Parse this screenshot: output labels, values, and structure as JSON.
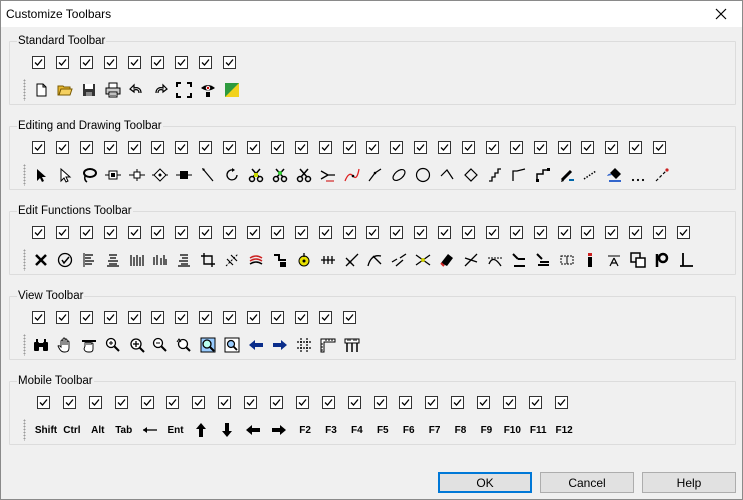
{
  "window": {
    "title": "Customize Toolbars"
  },
  "groups": {
    "standard": {
      "label": "Standard Toolbar",
      "icons": [
        "new-document-icon",
        "open-folder-icon",
        "save-icon",
        "print-icon",
        "undo-icon",
        "redo-icon",
        "full-extent-icon",
        "preview-eye-icon",
        "color-fill-icon"
      ]
    },
    "editing": {
      "label": "Editing and Drawing Toolbar",
      "icons": [
        "select-arrow-icon",
        "select-hollow-arrow-icon",
        "lasso-icon",
        "node-add-icon",
        "node-move-icon",
        "node-diamond-icon",
        "node-delete-icon",
        "pen-line-icon",
        "rotate-icon",
        "scissors-node-icon",
        "scissors-green-icon",
        "scissors-icon",
        "merge-line-icon",
        "curve-pink-icon",
        "polyline-icon",
        "ellipse-icon",
        "circle-icon",
        "angle-line-icon",
        "diamond-outline-icon",
        "stairs-icon",
        "step-line-icon",
        "connector-icon",
        "brush-icon",
        "dotted-line-icon",
        "fill-bucket-icon",
        "ellipsis-icon",
        "dashed-diagonal-icon"
      ]
    },
    "editfn": {
      "label": "Edit Functions Toolbar",
      "icons": [
        "delete-x-icon",
        "check-circle-icon",
        "align-left-icon",
        "align-center-icon",
        "distribute-vertical-icon",
        "distribute-bars-icon",
        "align-right-icon",
        "crop-icon",
        "trim-icon",
        "offset-red-icon",
        "step-down-icon",
        "sun-circle-icon",
        "parallel-line-icon",
        "extend-icon",
        "curve-cut-icon",
        "break-line-icon",
        "intersect-icon",
        "eraser-icon",
        "split-icon",
        "bend-line-icon",
        "join-down-icon",
        "join-stack-icon",
        "dashed-box-icon",
        "info-bar-icon",
        "text-anchor-icon",
        "overlap-box-icon",
        "pipe-joint-icon",
        "perpendicular-icon"
      ]
    },
    "view": {
      "label": "View Toolbar",
      "icons": [
        "binoculars-icon",
        "pan-hand-icon",
        "grab-hand-icon",
        "zoom-in-icon",
        "zoom-in-plus-icon",
        "zoom-out-icon",
        "zoom-previous-icon",
        "zoom-window-icon",
        "zoom-fit-icon",
        "back-arrow-icon",
        "forward-arrow-icon",
        "grid-icon",
        "ruler-corner-icon",
        "ruler-frame-icon"
      ]
    },
    "mobile": {
      "label": "Mobile Toolbar",
      "keys": [
        "Shift",
        "Ctrl",
        "Alt",
        "Tab",
        "left-arrow-long-icon",
        "Ent",
        "up-arrow-icon",
        "down-arrow-icon",
        "left-arrow-icon",
        "right-arrow-icon",
        "F2",
        "F3",
        "F4",
        "F5",
        "F6",
        "F7",
        "F8",
        "F9",
        "F10",
        "F11",
        "F12"
      ]
    }
  },
  "buttons": {
    "ok": "OK",
    "cancel": "Cancel",
    "help": "Help"
  },
  "colors": {
    "accent": "#0078d7",
    "checkbox_border": "#333333",
    "group_border": "#dcdcdc"
  }
}
